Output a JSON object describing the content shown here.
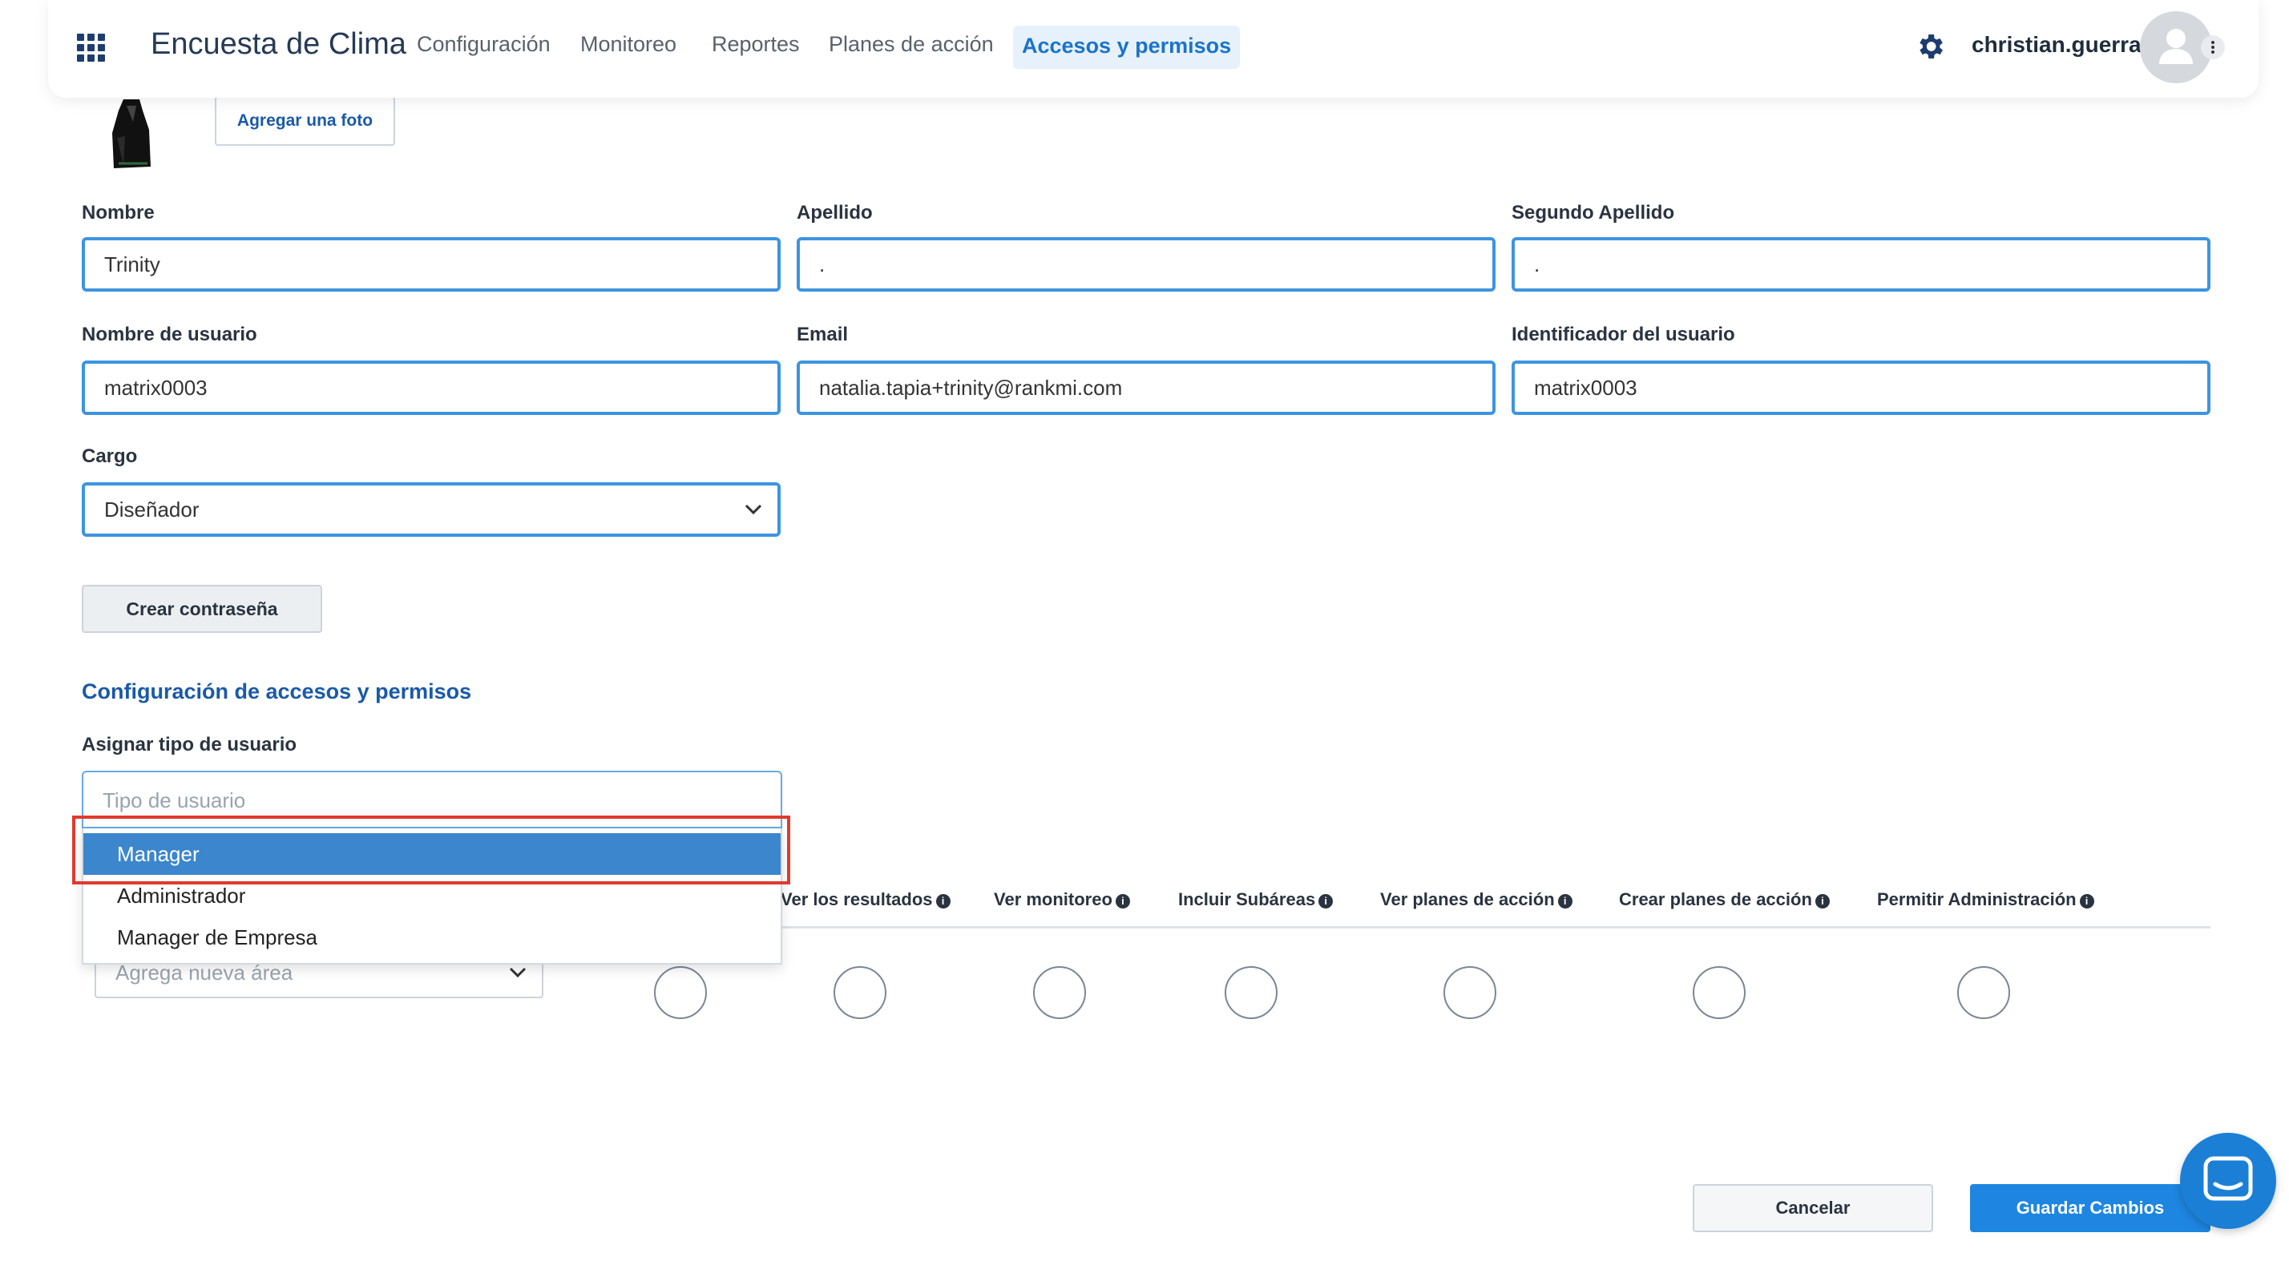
{
  "header": {
    "app_title": "Encuesta de Clima",
    "nav": [
      {
        "label": "Configuración"
      },
      {
        "label": "Monitoreo"
      },
      {
        "label": "Reportes"
      },
      {
        "label": "Planes de acción"
      },
      {
        "label": "Accesos y permisos",
        "active": true
      }
    ],
    "user_name": "christian.guerra"
  },
  "photo": {
    "button_label": "Agregar una foto"
  },
  "form": {
    "nombre": {
      "label": "Nombre",
      "value": "Trinity"
    },
    "apellido": {
      "label": "Apellido",
      "value": "."
    },
    "segundo_apellido": {
      "label": "Segundo Apellido",
      "value": "."
    },
    "usuario": {
      "label": "Nombre de usuario",
      "value": "matrix0003"
    },
    "email": {
      "label": "Email",
      "value": "natalia.tapia+trinity@rankmi.com"
    },
    "identificador": {
      "label": "Identificador del usuario",
      "value": "matrix0003"
    },
    "cargo": {
      "label": "Cargo",
      "value": "Diseñador"
    },
    "password_button": "Crear contraseña"
  },
  "access": {
    "section_title": "Configuración de accesos y permisos",
    "type_label": "Asignar tipo de usuario",
    "type_placeholder": "Tipo de usuario",
    "options": [
      {
        "label": "Manager",
        "selected": true
      },
      {
        "label": "Administrador"
      },
      {
        "label": "Manager de Empresa"
      }
    ],
    "area_placeholder": "Agrega nueva área",
    "columns": [
      "Ver los resultados",
      "Ver monitoreo",
      "Incluir Subáreas",
      "Ver planes de acción",
      "Crear planes de acción",
      "Permitir Administración"
    ]
  },
  "footer": {
    "cancel_label": "Cancelar",
    "save_label": "Guardar Cambios"
  },
  "colors": {
    "accent": "#1e86e0",
    "field_border": "#3d94e0",
    "selected_option": "#3b86cc",
    "highlight": "#e03a2e"
  }
}
